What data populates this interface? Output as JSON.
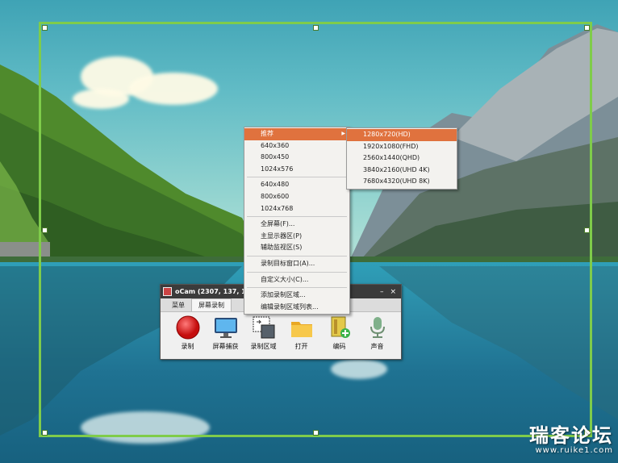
{
  "colors": {
    "selection_frame": "#7fcc4a",
    "menu_highlight": "#e0723e",
    "record_button": "#e21b1b"
  },
  "context_menu": {
    "items": [
      {
        "label": "推荐",
        "has_submenu": true,
        "highlighted": true
      },
      {
        "label": "640x360"
      },
      {
        "label": "800x450"
      },
      {
        "label": "1024x576"
      },
      {
        "separator": true
      },
      {
        "label": "640x480"
      },
      {
        "label": "800x600"
      },
      {
        "label": "1024x768"
      },
      {
        "separator": true
      },
      {
        "label": "全屏幕(F)..."
      },
      {
        "label": "主显示器区(P)"
      },
      {
        "label": "辅助监视区(S)"
      },
      {
        "separator": true
      },
      {
        "label": "录制目标窗口(A)..."
      },
      {
        "separator": true
      },
      {
        "label": "自定义大小(C)..."
      },
      {
        "separator": true
      },
      {
        "label": "添加录制区域..."
      },
      {
        "label": "编辑录制区域列表..."
      }
    ]
  },
  "submenu": {
    "items": [
      {
        "label": "1280x720(HD)",
        "highlighted": true
      },
      {
        "label": "1920x1080(FHD)"
      },
      {
        "label": "2560x1440(QHD)"
      },
      {
        "label": "3840x2160(UHD 4K)"
      },
      {
        "label": "7680x4320(UHD 8K)"
      }
    ]
  },
  "ocam": {
    "title": "oCam (2307, 137, 1024,",
    "minimize": "–",
    "close": "×",
    "tabs": [
      {
        "label": "菜单",
        "active": false
      },
      {
        "label": "屏幕录制",
        "active": true
      }
    ],
    "tools": [
      {
        "label": "录制",
        "icon": "record-icon"
      },
      {
        "label": "屏幕捕获",
        "icon": "monitor-icon"
      },
      {
        "label": "录制区域",
        "icon": "region-icon"
      },
      {
        "label": "打开",
        "icon": "folder-icon"
      },
      {
        "label": "编码",
        "icon": "codec-icon"
      },
      {
        "label": "声音",
        "icon": "microphone-icon"
      }
    ]
  },
  "watermark": {
    "title": "瑞客论坛",
    "url": "www.ruike1.com"
  }
}
